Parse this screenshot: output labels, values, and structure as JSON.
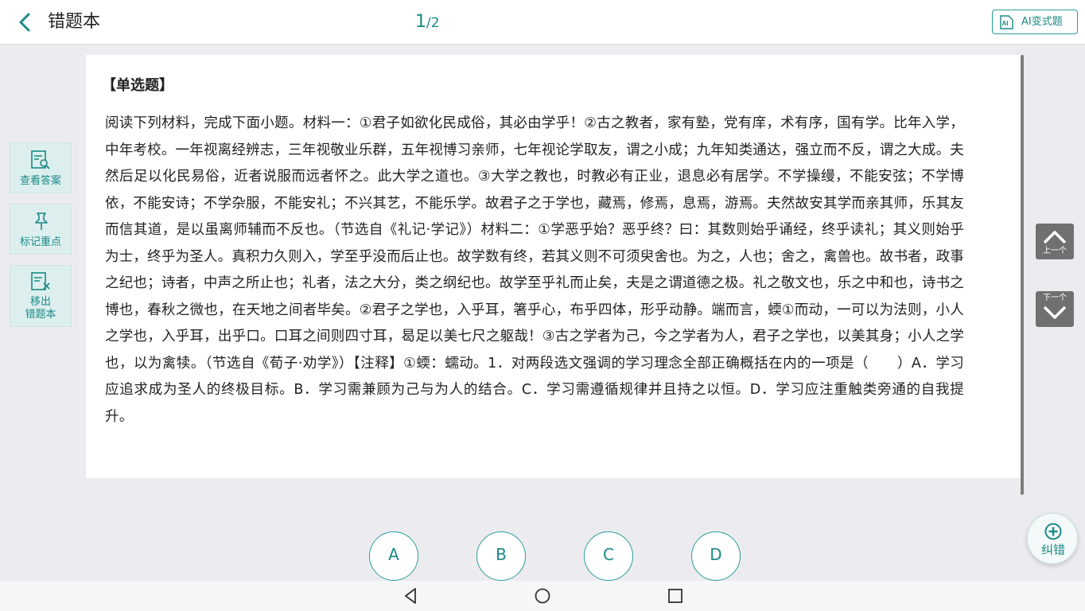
{
  "header": {
    "title": "错题本",
    "page_current": "1",
    "page_total": "/2",
    "ai_button": "AI变式题",
    "ai_icon_text": "AI"
  },
  "question": {
    "type_label": "【单选题】",
    "body": "阅读下列材料，完成下面小题。材料一：①君子如欲化民成俗，其必由学乎！②古之教者，家有塾，党有庠，术有序，国有学。比年入学，中年考校。一年视离经辨志，三年视敬业乐群，五年视博习亲师，七年视论学取友，谓之小成；九年知类通达，强立而不反，谓之大成。夫然后足以化民易俗，近者说服而远者怀之。此大学之道也。③大学之教也，时教必有正业，退息必有居学。不学操缦，不能安弦；不学博依，不能安诗；不学杂服，不能安礼；不兴其艺，不能乐学。故君子之于学也，藏焉，修焉，息焉，游焉。夫然故安其学而亲其师，乐其友而信其道，是以虽离师辅而不反也。（节选自《礼记·学记》）材料二：①学恶乎始？恶乎终？曰：其数则始乎诵经，终乎读礼；其义则始乎为士，终乎为圣人。真积力久则入，学至乎没而后止也。故学数有终，若其义则不可须臾舍也。为之，人也；舍之，禽兽也。故书者，政事之纪也；诗者，中声之所止也；礼者，法之大分，类之纲纪也。故学至乎礼而止矣，夫是之谓道德之极。礼之敬文也，乐之中和也，诗书之博也，春秋之微也，在天地之间者毕矣。②君子之学也，入乎耳，箸乎心，布乎四体，形乎动静。端而言，蝡①而动，一可以为法则，小人之学也，入乎耳，出乎口。口耳之间则四寸耳，曷足以美七尺之躯哉！③古之学者为己，今之学者为人，君子之学也，以美其身；小人之学也，以为禽犊。（节选自《荀子·劝学》）【注释】①蝡：蠕动。1．对两段选文强调的学习理念全部正确概括在内的一项是（　　）A．学习应追求成为圣人的终极目标。B．学习需兼顾为己与为人的结合。C．学习需遵循规律并且持之以恒。D．学习应注重触类旁通的自我提升。"
  },
  "sidebar": {
    "view_answer": "查看答案",
    "mark_key_point": "标记重点",
    "remove_line1": "移出",
    "remove_line2": "错题本"
  },
  "nav": {
    "prev": "上一个",
    "next": "下一个"
  },
  "fab": {
    "label": "纠错"
  },
  "options": [
    "A",
    "B",
    "C",
    "D"
  ],
  "colors": {
    "accent": "#1a8a86",
    "accent_border": "#2a9d98",
    "side_button_bg": "#dcefee",
    "nav_button_bg": "#6f7070",
    "page_bg": "#ececf0"
  },
  "icons": {
    "back": "chevron-left-icon",
    "ai": "ai-icon",
    "view_answer": "document-search-icon",
    "mark": "pin-icon",
    "remove": "document-remove-icon",
    "prev": "chevron-up-icon",
    "next": "chevron-down-icon",
    "fab": "plus-circle-icon",
    "sys_back": "triangle-back-icon",
    "sys_home": "circle-home-icon",
    "sys_recent": "square-recents-icon"
  }
}
